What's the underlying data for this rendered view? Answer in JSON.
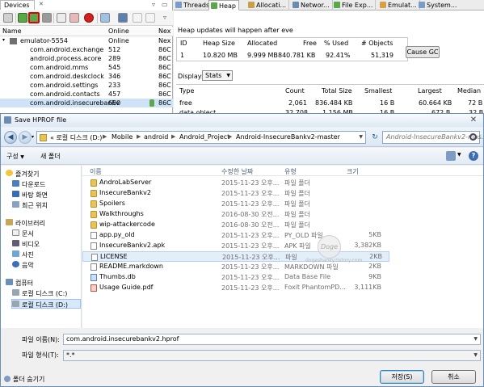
{
  "ddms": {
    "devices_tab": "Devices",
    "devices_close": "✕",
    "columns": {
      "name": "Name",
      "online": "Online",
      "next": "Nex"
    },
    "rows": [
      {
        "name": "emulator-5554",
        "status": "Online",
        "extra": "Nex"
      },
      {
        "name": "com.android.exchange",
        "status": "512",
        "extra": "86C"
      },
      {
        "name": "android.process.acore",
        "status": "289",
        "extra": "86C"
      },
      {
        "name": "com.android.mms",
        "status": "545",
        "extra": "86C"
      },
      {
        "name": "com.android.deskclock",
        "status": "346",
        "extra": "86C"
      },
      {
        "name": "com.android.settings",
        "status": "233",
        "extra": "86C"
      },
      {
        "name": "com.android.contacts",
        "status": "457",
        "extra": "86C"
      },
      {
        "name": "com.android.insecurebankv",
        "status": "650",
        "extra": "86C"
      }
    ],
    "tabs": [
      "Threads",
      "Heap",
      "Allocati...",
      "Networ...",
      "File Exp...",
      "Emulat...",
      "System..."
    ],
    "heap_msg": "Heap updates will happen after eve",
    "heap_headers": [
      "ID",
      "Heap Size",
      "Allocated",
      "Free",
      "% Used",
      "# Objects"
    ],
    "heap_values": [
      "1",
      "10.820 MB",
      "9.999 MB",
      "840.781 KB",
      "92.41%",
      "51,319"
    ],
    "cause_gc": "Cause GC",
    "display_label": "Display:",
    "display_value": "Stats",
    "stats_headers": [
      "Type",
      "Count",
      "Total Size",
      "Smallest",
      "Largest",
      "Median"
    ],
    "stats_rows": [
      [
        "free",
        "2,061",
        "836.484 KB",
        "16 B",
        "60.664 KB",
        "72 B"
      ],
      [
        "data object",
        "32,708",
        "1.156 MB",
        "16 B",
        "672 B",
        "32 B"
      ]
    ]
  },
  "dialog": {
    "title": "Save HPROF file",
    "breadcrumb": [
      "« 로컬 디스크 (D:)",
      "Mobile",
      "android",
      "Android_Project",
      "Android-InsecureBankv2-master"
    ],
    "search_placeholder": "Android-InsecureBankv2-mas...",
    "organize": "구성",
    "new_folder": "새 폴더",
    "nav": {
      "favorites": "즐겨찾기",
      "downloads": "다운로드",
      "desktop": "바탕 화면",
      "recent": "최근 위치",
      "libraries": "라이브러리",
      "documents": "문서",
      "videos": "비디오",
      "pictures": "사진",
      "music": "음악",
      "computer": "컴퓨터",
      "drive_c": "로컬 디스크 (C:)",
      "drive_d": "로컬 디스크 (D:)"
    },
    "columns": {
      "name": "이름",
      "date": "수정한 날짜",
      "type": "유형",
      "size": "크기"
    },
    "files": [
      {
        "name": "AndroLabServer",
        "date": "2015-11-23 오후...",
        "type": "파일 폴더",
        "size": "",
        "icon": "folder"
      },
      {
        "name": "InsecureBankv2",
        "date": "2015-11-23 오후...",
        "type": "파일 폴더",
        "size": "",
        "icon": "folder"
      },
      {
        "name": "Spoilers",
        "date": "2015-11-23 오후...",
        "type": "파일 폴더",
        "size": "",
        "icon": "folder"
      },
      {
        "name": "Walkthroughs",
        "date": "2016-08-30 오전...",
        "type": "파일 폴더",
        "size": "",
        "icon": "folder"
      },
      {
        "name": "wip-attackercode",
        "date": "2016-08-30 오전...",
        "type": "파일 폴더",
        "size": "",
        "icon": "folder"
      },
      {
        "name": "app.py_old",
        "date": "2015-11-23 오후...",
        "type": "PY_OLD 파일",
        "size": "5KB",
        "icon": "file"
      },
      {
        "name": "InsecureBankv2.apk",
        "date": "2015-11-23 오후...",
        "type": "APK 파일",
        "size": "3,382KB",
        "icon": "file"
      },
      {
        "name": "LICENSE",
        "date": "2015-11-23 오후...",
        "type": "파일",
        "size": "2KB",
        "icon": "file"
      },
      {
        "name": "README.markdown",
        "date": "2015-11-23 오후...",
        "type": "MARKDOWN 파일",
        "size": "2KB",
        "icon": "file"
      },
      {
        "name": "Thumbs.db",
        "date": "2015-11-23 오후...",
        "type": "Data Base File",
        "size": "9KB",
        "icon": "imgf"
      },
      {
        "name": "Usage Guide.pdf",
        "date": "2015-11-23 오후...",
        "type": "Foxit PhantomPD...",
        "size": "3,111KB",
        "icon": "pdf"
      }
    ],
    "watermark": "Doge",
    "watermark_url": "dogeshanky.tistory.com",
    "filename_label": "파일 이름(N):",
    "filename_value": "com.android.insecurebankv2.hprof",
    "filetype_label": "파일 형식(T):",
    "filetype_value": "*.*",
    "hide_folders": "폴더 숨기기",
    "save": "저장(S)",
    "cancel": "취소"
  }
}
